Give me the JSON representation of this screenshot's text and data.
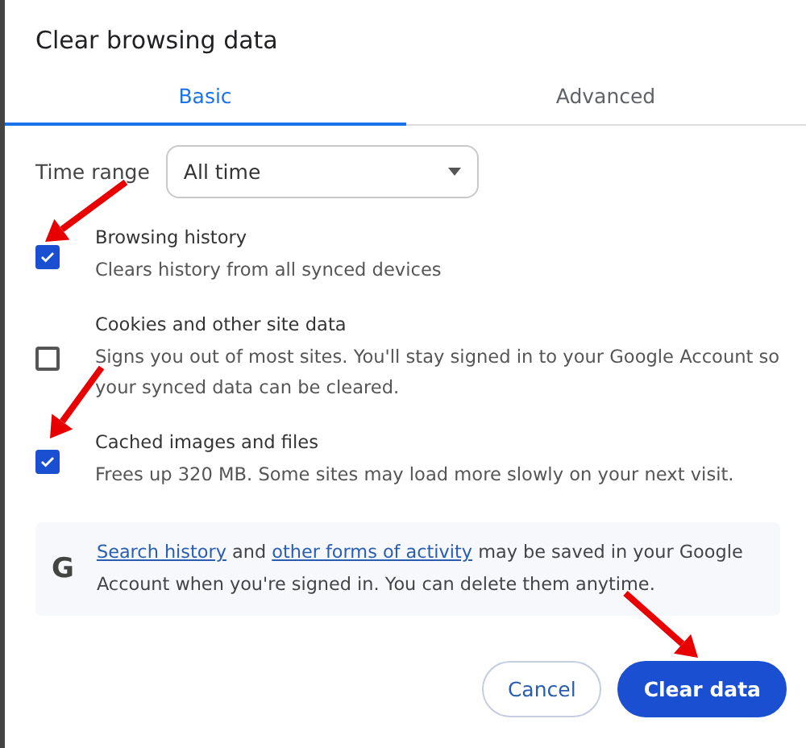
{
  "dialog": {
    "title": "Clear browsing data"
  },
  "tabs": [
    {
      "label": "Basic",
      "selected": true
    },
    {
      "label": "Advanced",
      "selected": false
    }
  ],
  "time_range": {
    "label": "Time range",
    "value": "All time"
  },
  "options": [
    {
      "title": "Browsing history",
      "description": "Clears history from all synced devices",
      "checked": true,
      "annotated": true
    },
    {
      "title": "Cookies and other site data",
      "description": "Signs you out of most sites. You'll stay signed in to your Google Account so your synced data can be cleared.",
      "checked": false,
      "annotated": false
    },
    {
      "title": "Cached images and files",
      "description": "Frees up 320 MB. Some sites may load more slowly on your next visit.",
      "checked": true,
      "annotated": true
    }
  ],
  "info": {
    "icon": "G",
    "parts": [
      {
        "kind": "link",
        "text": "Search history"
      },
      {
        "kind": "text",
        "text": " and "
      },
      {
        "kind": "link",
        "text": "other forms of activity"
      },
      {
        "kind": "text",
        "text": " may be saved in your Google Account when you're signed in. You can delete them anytime."
      }
    ]
  },
  "buttons": [
    {
      "kind": "secondary",
      "label": "Cancel",
      "annotated": false
    },
    {
      "kind": "primary",
      "label": "Clear data",
      "annotated": true
    }
  ]
}
